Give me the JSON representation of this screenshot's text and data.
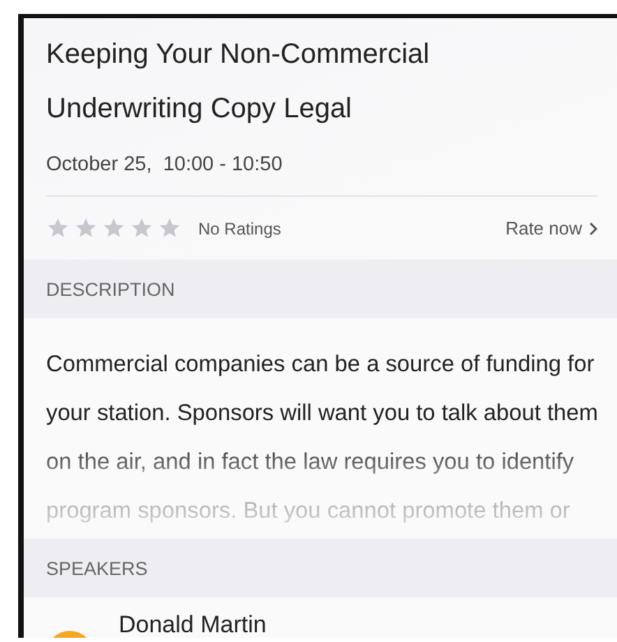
{
  "session": {
    "title": "Keeping Your Non-Commercial Underwriting Copy Legal",
    "time": "October 25,  10:00 - 10:50"
  },
  "rating": {
    "stars": 0,
    "label": "No Ratings",
    "action": "Rate now"
  },
  "description": {
    "heading": "DESCRIPTION",
    "text": "Commercial companies can be a source of funding for your station. Sponsors will want you to talk about them on the air, and in fact the law requires you to identify program sponsors. But you cannot promote them or"
  },
  "speakers": {
    "heading": "SPEAKERS",
    "items": [
      {
        "name": "Donald Martin",
        "color": "#f5a623"
      }
    ]
  }
}
